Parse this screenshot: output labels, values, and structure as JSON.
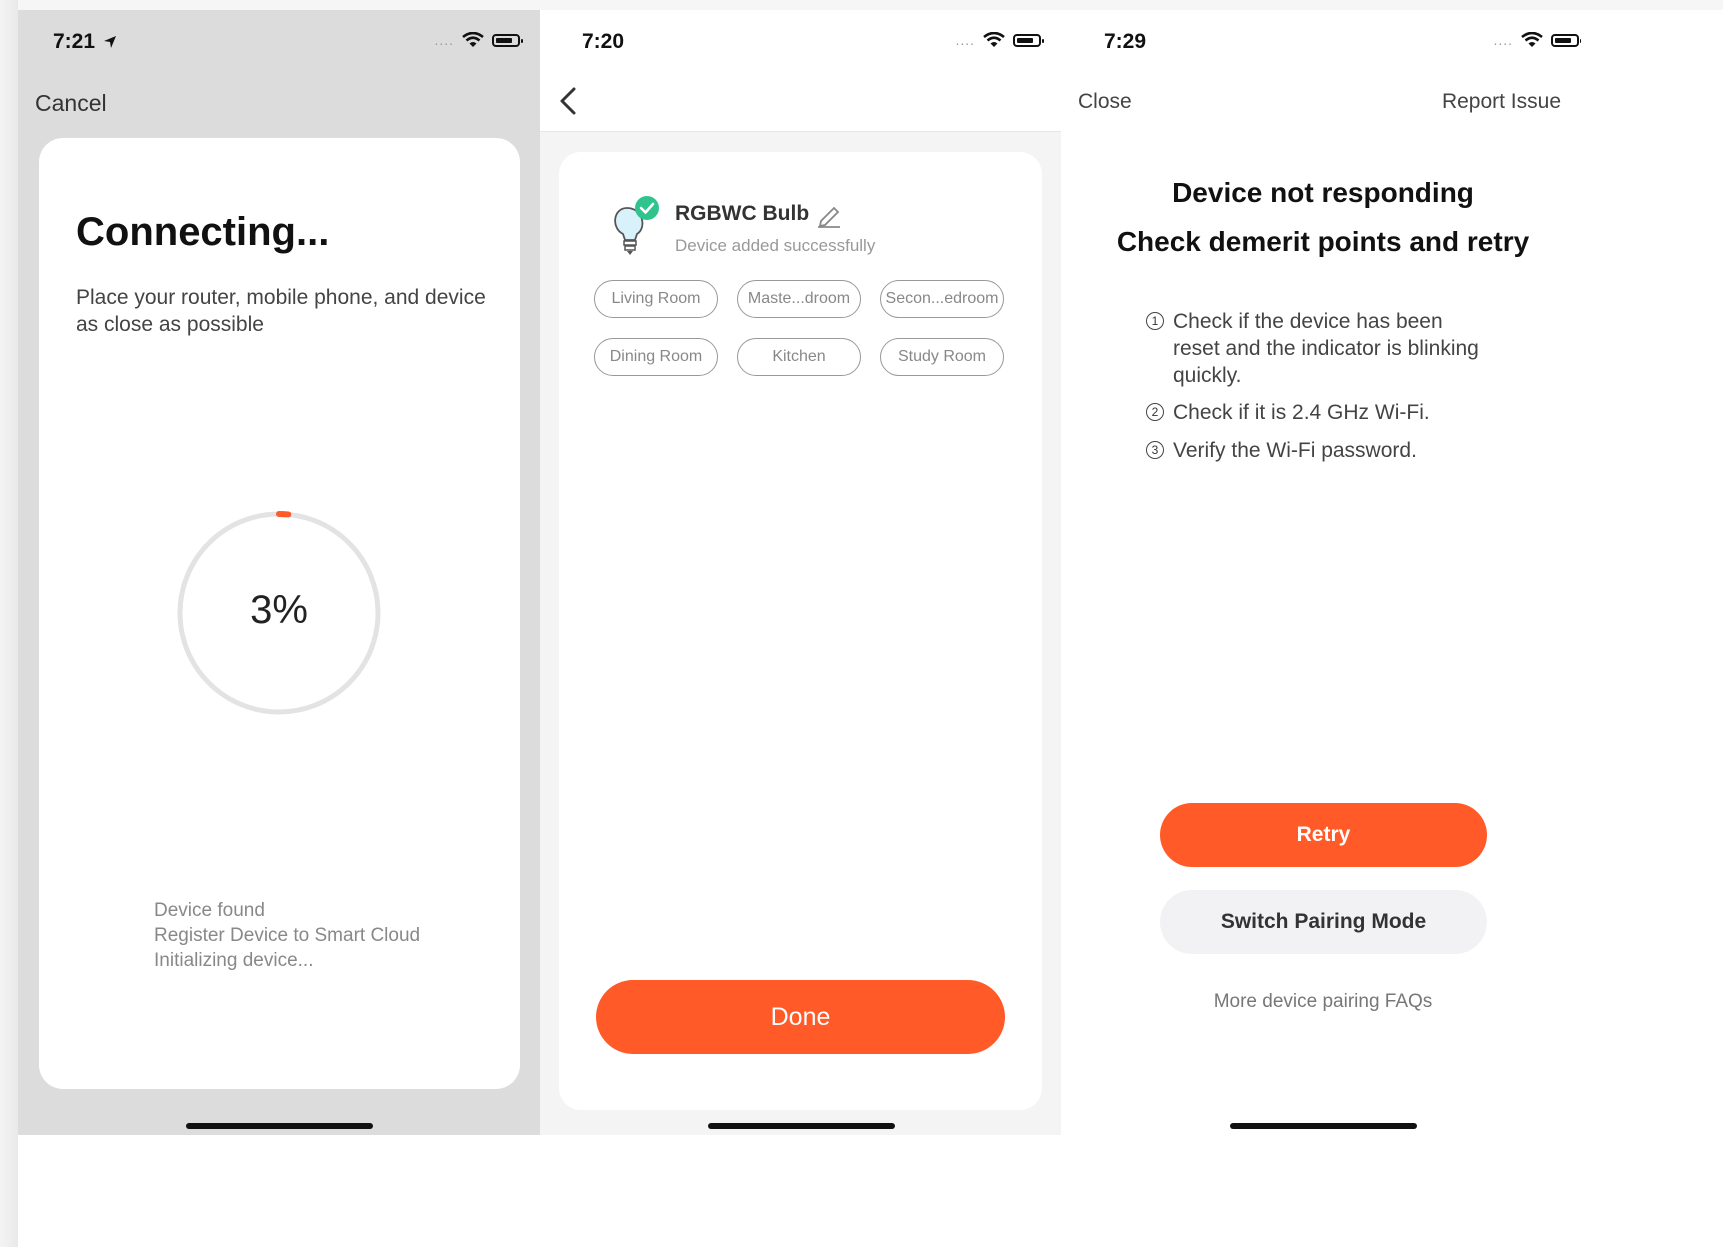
{
  "colors": {
    "accent": "#ff5a27",
    "success": "#2fc48d"
  },
  "screen1": {
    "status_time": "7:21",
    "cancel_label": "Cancel",
    "title": "Connecting...",
    "description": "Place your router, mobile phone, and device as close as possible",
    "progress_percent": 3,
    "progress_label": "3%",
    "steps": [
      "Device found",
      "Register Device to Smart Cloud",
      "Initializing device..."
    ]
  },
  "screen2": {
    "status_time": "7:20",
    "device_name": "RGBWC Bulb",
    "device_status": "Device added successfully",
    "rooms": [
      "Living Room",
      "Maste...droom",
      "Secon...edroom",
      "Dining Room",
      "Kitchen",
      "Study Room"
    ],
    "done_label": "Done"
  },
  "screen3": {
    "status_time": "7:29",
    "close_label": "Close",
    "report_label": "Report Issue",
    "title_line1": "Device not responding",
    "title_line2": "Check demerit points and retry",
    "tips": [
      {
        "num": "1",
        "text": "Check if the device has been reset and the indicator is blinking quickly."
      },
      {
        "num": "2",
        "text": "Check if it is 2.4 GHz Wi-Fi."
      },
      {
        "num": "3",
        "text": "Verify the Wi-Fi password."
      }
    ],
    "retry_label": "Retry",
    "switch_label": "Switch Pairing Mode",
    "faq_label": "More device pairing FAQs"
  }
}
